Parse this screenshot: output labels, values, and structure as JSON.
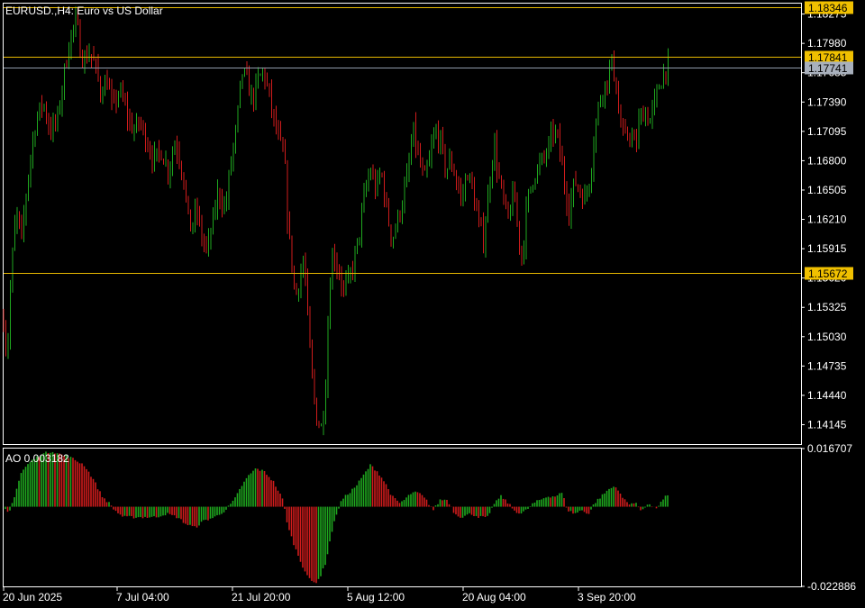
{
  "window": {
    "title": "EURUSD.,H4:  Euro vs US Dollar",
    "indicator_label": "AO 0.003182"
  },
  "colors": {
    "background": "#000000",
    "frame": "#ffffff",
    "bull": "#1fa81f",
    "bear": "#d01c1c",
    "level_line": "#e6b800",
    "bid_line": "#8f9bab",
    "level_tag_bg": "#f0c000",
    "bid_tag_bg": "#a8b0bc"
  },
  "chart_data": [
    {
      "type": "candlestick",
      "symbol": "EURUSD.",
      "timeframe": "H4",
      "title": "EURUSD.,H4:  Euro vs US Dollar",
      "ylim": [
        1.1395,
        1.1838
      ],
      "y_ticks": [
        "1.18275",
        "1.17980",
        "1.17685",
        "1.17390",
        "1.17095",
        "1.16800",
        "1.16505",
        "1.16210",
        "1.15915",
        "1.15620",
        "1.15325",
        "1.15030",
        "1.14735",
        "1.14440",
        "1.14145"
      ],
      "x_ticks": [
        "20 Jun 2025",
        "7 Jul 04:00",
        "21 Jul 20:00",
        "5 Aug 12:00",
        "20 Aug 04:00",
        "3 Sep 20:00"
      ],
      "horizontal_levels": [
        {
          "label": "1.18346",
          "value": 1.18346,
          "kind": "level"
        },
        {
          "label": "1.17841",
          "value": 1.17841,
          "kind": "level"
        },
        {
          "label": "1.17741",
          "value": 1.17741,
          "kind": "bid"
        },
        {
          "label": "1.15672",
          "value": 1.15672,
          "kind": "level"
        }
      ],
      "grid": false,
      "close_waypoints": [
        [
          0,
          1.152
        ],
        [
          4,
          1.148
        ],
        [
          8,
          1.156
        ],
        [
          14,
          1.163
        ],
        [
          20,
          1.16
        ],
        [
          28,
          1.167
        ],
        [
          36,
          1.172
        ],
        [
          44,
          1.174
        ],
        [
          52,
          1.171
        ],
        [
          60,
          1.172
        ],
        [
          68,
          1.177
        ],
        [
          76,
          1.181
        ],
        [
          82,
          1.182
        ],
        [
          86,
          1.179
        ],
        [
          90,
          1.178
        ],
        [
          96,
          1.179
        ],
        [
          104,
          1.177
        ],
        [
          108,
          1.175
        ],
        [
          116,
          1.176
        ],
        [
          122,
          1.173
        ],
        [
          128,
          1.175
        ],
        [
          134,
          1.174
        ],
        [
          140,
          1.172
        ],
        [
          146,
          1.171
        ],
        [
          152,
          1.172
        ],
        [
          160,
          1.17
        ],
        [
          168,
          1.168
        ],
        [
          176,
          1.169
        ],
        [
          184,
          1.167
        ],
        [
          192,
          1.17
        ],
        [
          200,
          1.167
        ],
        [
          208,
          1.161
        ],
        [
          216,
          1.163
        ],
        [
          222,
          1.16
        ],
        [
          228,
          1.159
        ],
        [
          234,
          1.162
        ],
        [
          240,
          1.165
        ],
        [
          248,
          1.163
        ],
        [
          254,
          1.168
        ],
        [
          260,
          1.171
        ],
        [
          266,
          1.177
        ],
        [
          272,
          1.176
        ],
        [
          278,
          1.174
        ],
        [
          284,
          1.176
        ],
        [
          290,
          1.177
        ],
        [
          296,
          1.175
        ],
        [
          302,
          1.172
        ],
        [
          308,
          1.17
        ],
        [
          314,
          1.168
        ],
        [
          318,
          1.161
        ],
        [
          322,
          1.158
        ],
        [
          326,
          1.154
        ],
        [
          330,
          1.156
        ],
        [
          336,
          1.158
        ],
        [
          342,
          1.149
        ],
        [
          346,
          1.145
        ],
        [
          350,
          1.142
        ],
        [
          356,
          1.141
        ],
        [
          360,
          1.146
        ],
        [
          364,
          1.155
        ],
        [
          368,
          1.159
        ],
        [
          374,
          1.157
        ],
        [
          380,
          1.155
        ],
        [
          386,
          1.156
        ],
        [
          392,
          1.158
        ],
        [
          398,
          1.161
        ],
        [
          404,
          1.165
        ],
        [
          410,
          1.167
        ],
        [
          416,
          1.165
        ],
        [
          422,
          1.167
        ],
        [
          428,
          1.163
        ],
        [
          434,
          1.16
        ],
        [
          440,
          1.162
        ],
        [
          446,
          1.164
        ],
        [
          452,
          1.167
        ],
        [
          458,
          1.171
        ],
        [
          464,
          1.168
        ],
        [
          470,
          1.166
        ],
        [
          476,
          1.168
        ],
        [
          482,
          1.171
        ],
        [
          488,
          1.17
        ],
        [
          494,
          1.167
        ],
        [
          500,
          1.168
        ],
        [
          506,
          1.166
        ],
        [
          512,
          1.164
        ],
        [
          518,
          1.167
        ],
        [
          524,
          1.165
        ],
        [
          530,
          1.162
        ],
        [
          536,
          1.16
        ],
        [
          542,
          1.165
        ],
        [
          548,
          1.17
        ],
        [
          552,
          1.167
        ],
        [
          558,
          1.164
        ],
        [
          564,
          1.162
        ],
        [
          570,
          1.165
        ],
        [
          576,
          1.16
        ],
        [
          580,
          1.158
        ],
        [
          584,
          1.163
        ],
        [
          590,
          1.166
        ],
        [
          596,
          1.167
        ],
        [
          602,
          1.168
        ],
        [
          608,
          1.169
        ],
        [
          614,
          1.171
        ],
        [
          620,
          1.17
        ],
        [
          626,
          1.166
        ],
        [
          632,
          1.163
        ],
        [
          638,
          1.166
        ],
        [
          644,
          1.165
        ],
        [
          650,
          1.164
        ],
        [
          656,
          1.167
        ],
        [
          662,
          1.172
        ],
        [
          668,
          1.175
        ],
        [
          674,
          1.176
        ],
        [
          680,
          1.178
        ],
        [
          684,
          1.176
        ],
        [
          688,
          1.172
        ],
        [
          694,
          1.17
        ],
        [
          700,
          1.171
        ],
        [
          706,
          1.169
        ],
        [
          710,
          1.172
        ],
        [
          716,
          1.173
        ],
        [
          722,
          1.172
        ],
        [
          728,
          1.174
        ],
        [
          734,
          1.176
        ],
        [
          740,
          1.1774
        ]
      ],
      "ao_waypoints": [
        [
          0,
          -0.0005
        ],
        [
          6,
          -0.002
        ],
        [
          12,
          0.003
        ],
        [
          20,
          0.01
        ],
        [
          30,
          0.013
        ],
        [
          42,
          0.015
        ],
        [
          54,
          0.016
        ],
        [
          64,
          0.015
        ],
        [
          76,
          0.014
        ],
        [
          90,
          0.012
        ],
        [
          100,
          0.008
        ],
        [
          110,
          0.003
        ],
        [
          118,
          0.001
        ],
        [
          124,
          -0.001
        ],
        [
          134,
          -0.003
        ],
        [
          146,
          -0.003
        ],
        [
          158,
          -0.003
        ],
        [
          170,
          -0.003
        ],
        [
          182,
          -0.002
        ],
        [
          194,
          -0.003
        ],
        [
          204,
          -0.005
        ],
        [
          214,
          -0.006
        ],
        [
          224,
          -0.004
        ],
        [
          236,
          -0.003
        ],
        [
          248,
          -0.001
        ],
        [
          258,
          0.002
        ],
        [
          266,
          0.006
        ],
        [
          274,
          0.009
        ],
        [
          282,
          0.011
        ],
        [
          292,
          0.01
        ],
        [
          302,
          0.007
        ],
        [
          312,
          0.002
        ],
        [
          318,
          -0.006
        ],
        [
          326,
          -0.012
        ],
        [
          334,
          -0.017
        ],
        [
          342,
          -0.021
        ],
        [
          348,
          -0.022
        ],
        [
          354,
          -0.02
        ],
        [
          360,
          -0.016
        ],
        [
          366,
          -0.008
        ],
        [
          372,
          -0.002
        ],
        [
          378,
          0.002
        ],
        [
          386,
          0.004
        ],
        [
          394,
          0.006
        ],
        [
          402,
          0.009
        ],
        [
          410,
          0.012
        ],
        [
          418,
          0.01
        ],
        [
          426,
          0.007
        ],
        [
          434,
          0.003
        ],
        [
          442,
          0.001
        ],
        [
          448,
          0.002
        ],
        [
          456,
          0.004
        ],
        [
          464,
          0.004
        ],
        [
          472,
          0.002
        ],
        [
          480,
          -0.001
        ],
        [
          488,
          0.002
        ],
        [
          496,
          0.002
        ],
        [
          504,
          -0.002
        ],
        [
          512,
          -0.003
        ],
        [
          522,
          -0.002
        ],
        [
          532,
          -0.003
        ],
        [
          542,
          -0.003
        ],
        [
          548,
          0.001
        ],
        [
          556,
          0.003
        ],
        [
          564,
          0.001
        ],
        [
          570,
          -0.001
        ],
        [
          578,
          -0.002
        ],
        [
          584,
          -0.001
        ],
        [
          592,
          0.001
        ],
        [
          600,
          0.002
        ],
        [
          608,
          0.003
        ],
        [
          616,
          0.003
        ],
        [
          624,
          0.004
        ],
        [
          630,
          -0.001
        ],
        [
          638,
          -0.002
        ],
        [
          646,
          -0.001
        ],
        [
          654,
          -0.002
        ],
        [
          660,
          0.001
        ],
        [
          668,
          0.003
        ],
        [
          676,
          0.005
        ],
        [
          684,
          0.006
        ],
        [
          690,
          0.003
        ],
        [
          698,
          0.001
        ],
        [
          706,
          0.001
        ],
        [
          712,
          -0.001
        ],
        [
          720,
          0.0008
        ],
        [
          728,
          -0.0006
        ],
        [
          734,
          0.001
        ],
        [
          740,
          0.003
        ]
      ]
    },
    {
      "type": "bar",
      "name": "AO",
      "title": "AO 0.003182",
      "ylim": [
        -0.022886,
        0.016707
      ],
      "y_ticks": [
        "0.016707",
        "-0.022886"
      ]
    }
  ]
}
